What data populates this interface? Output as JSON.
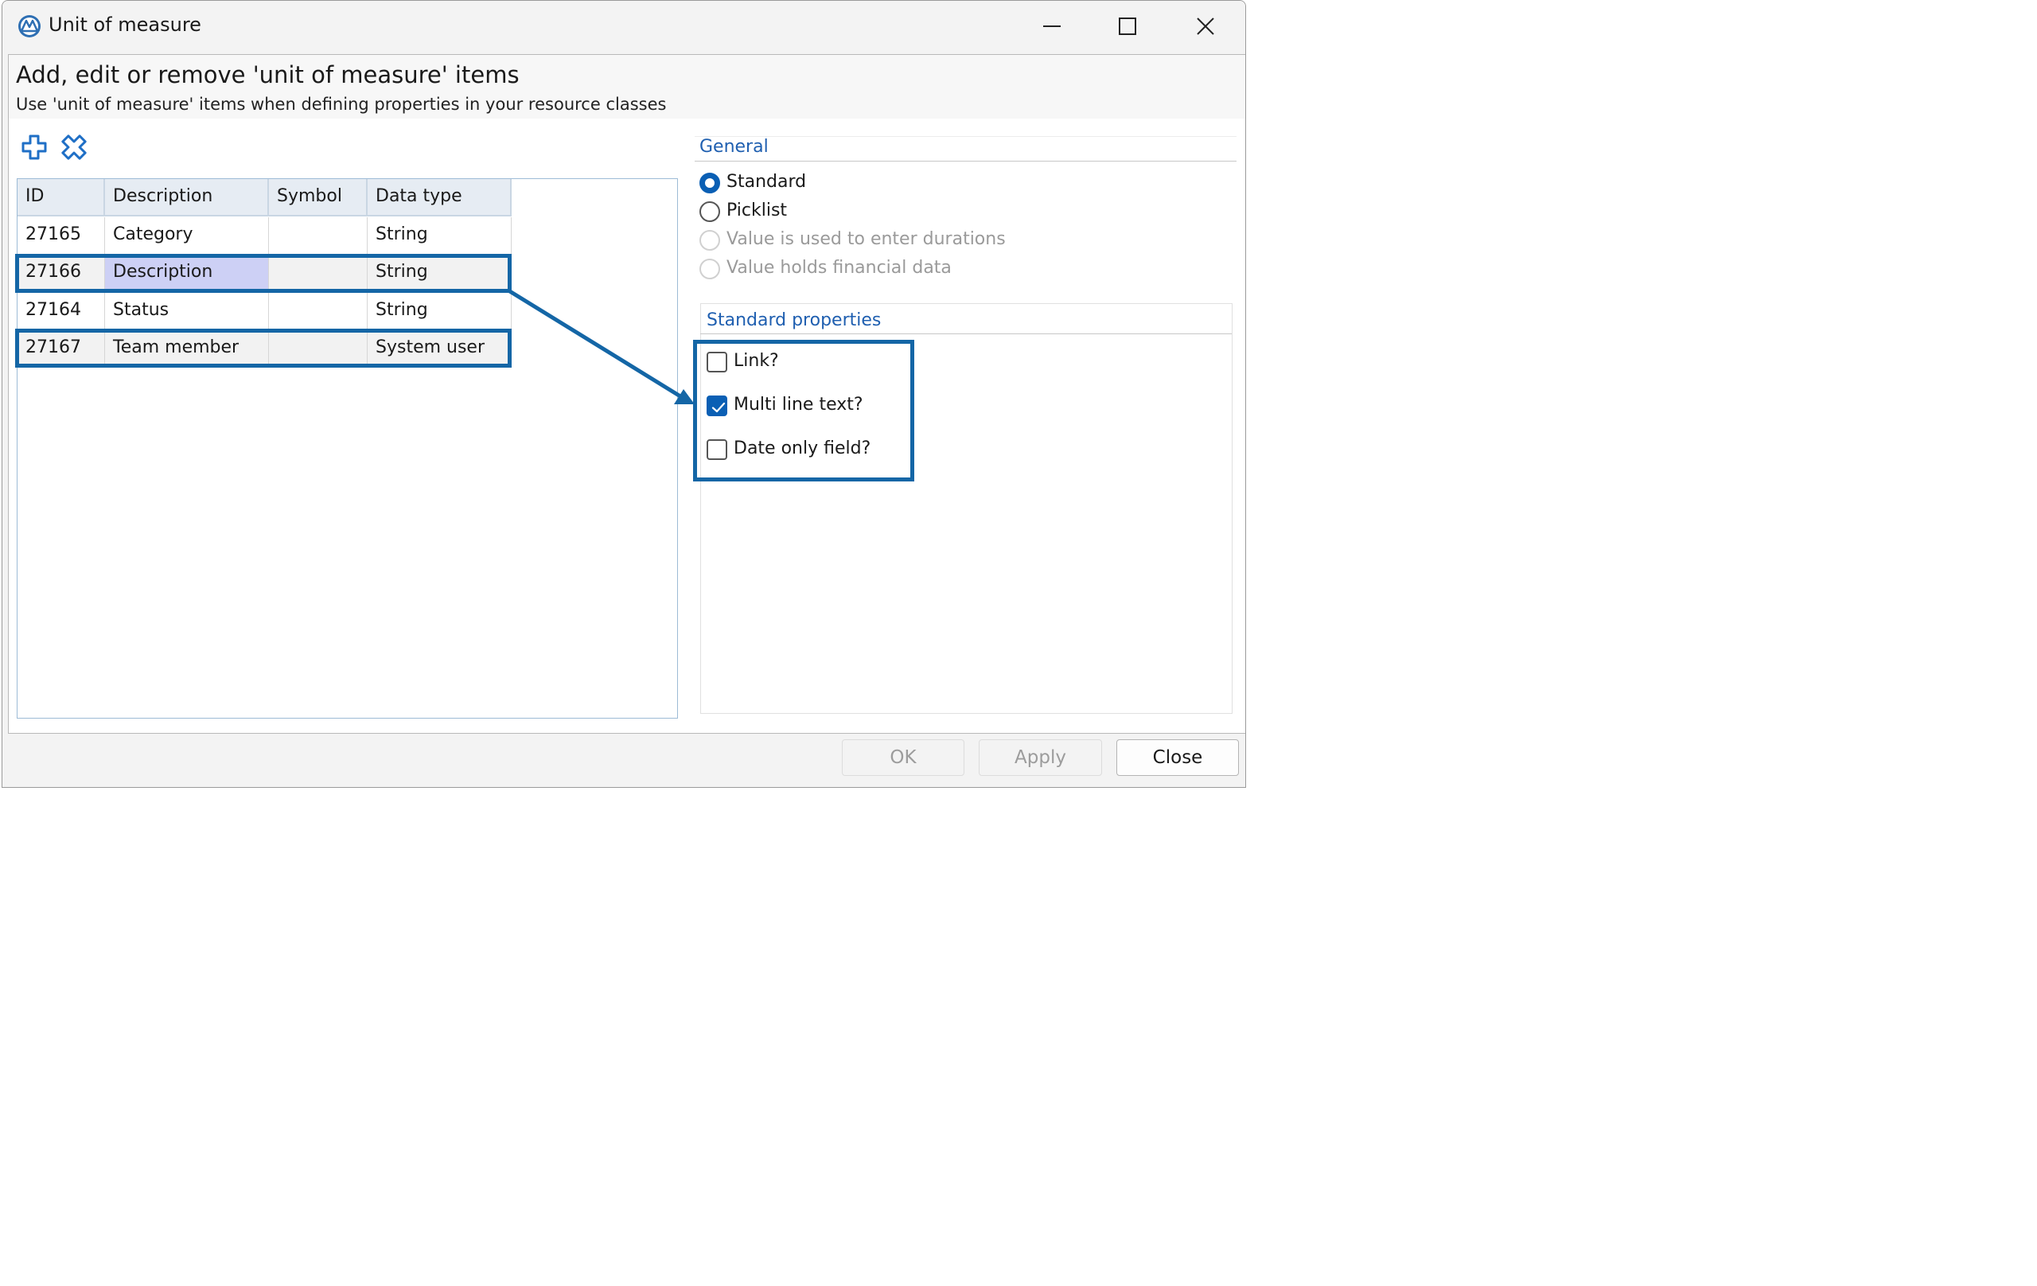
{
  "window": {
    "title": "Unit of measure"
  },
  "header": {
    "title": "Add, edit or remove 'unit of measure' items",
    "subtitle": "Use 'unit of measure' items when defining properties in your resource classes"
  },
  "grid": {
    "columns": [
      "ID",
      "Description",
      "Symbol",
      "Data type"
    ],
    "rows": [
      {
        "id": "27165",
        "description": "Category",
        "symbol": "",
        "data_type": "String"
      },
      {
        "id": "27166",
        "description": "Description",
        "symbol": "",
        "data_type": "String"
      },
      {
        "id": "27164",
        "description": "Status",
        "symbol": "",
        "data_type": "String"
      },
      {
        "id": "27167",
        "description": "Team member",
        "symbol": "",
        "data_type": "System user"
      }
    ],
    "selected_row": "27166"
  },
  "general": {
    "label": "General",
    "options": [
      {
        "label": "Standard",
        "checked": true,
        "enabled": true
      },
      {
        "label": "Picklist",
        "checked": false,
        "enabled": true
      },
      {
        "label": "Value is used to enter durations",
        "checked": false,
        "enabled": false
      },
      {
        "label": "Value holds financial data",
        "checked": false,
        "enabled": false
      }
    ]
  },
  "standard_properties": {
    "label": "Standard properties",
    "options": [
      {
        "label": "Link?",
        "checked": false
      },
      {
        "label": "Multi line text?",
        "checked": true
      },
      {
        "label": "Date only field?",
        "checked": false
      }
    ]
  },
  "footer": {
    "ok_label": "OK",
    "apply_label": "Apply",
    "close_label": "Close"
  },
  "colors": {
    "accent": "#0a5fb4",
    "annotation": "#1466a6",
    "group_label": "#1f5fb0",
    "selection": "#cdd0f5"
  }
}
